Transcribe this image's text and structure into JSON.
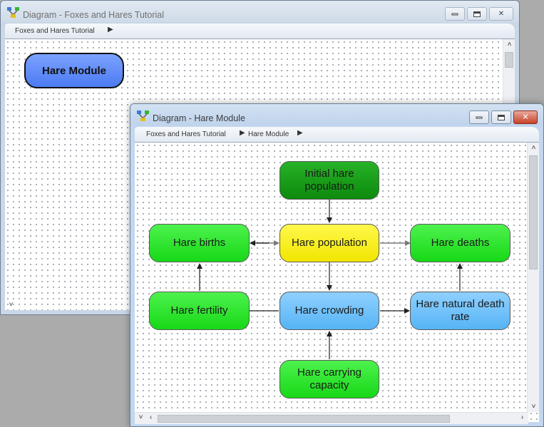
{
  "background_window": {
    "title": "Diagram - Foxes and Hares Tutorial",
    "breadcrumb": [
      "Foxes and Hares Tutorial"
    ],
    "module_label": "Hare Module"
  },
  "foreground_window": {
    "title": "Diagram - Hare Module",
    "breadcrumb": [
      "Foxes and Hares Tutorial",
      "Hare Module"
    ],
    "nodes": {
      "initial_hare_population": "Initial hare population",
      "hare_population": "Hare population",
      "hare_births": "Hare births",
      "hare_deaths": "Hare deaths",
      "hare_fertility": "Hare fertility",
      "hare_crowding": "Hare crowding",
      "hare_natural_death_rate": "Hare natural death rate",
      "hare_carrying_capacity": "Hare carrying capacity"
    }
  },
  "icons": {
    "breadcrumb_separator": "▶",
    "window_controls": [
      "minimize-icon",
      "maximize-icon",
      "close-icon"
    ],
    "scroll_arrows": [
      "chevron-up-icon",
      "chevron-down-icon",
      "chevron-left-icon",
      "chevron-right-icon"
    ]
  },
  "colors": {
    "module_fill": "#5d88f6",
    "variable_green": "#22e022",
    "stock_yellow": "#f7ef1c",
    "converter_blue": "#67bdf8",
    "initial_value_green": "#1a9c1a",
    "close_button_red": "#c7432b"
  }
}
